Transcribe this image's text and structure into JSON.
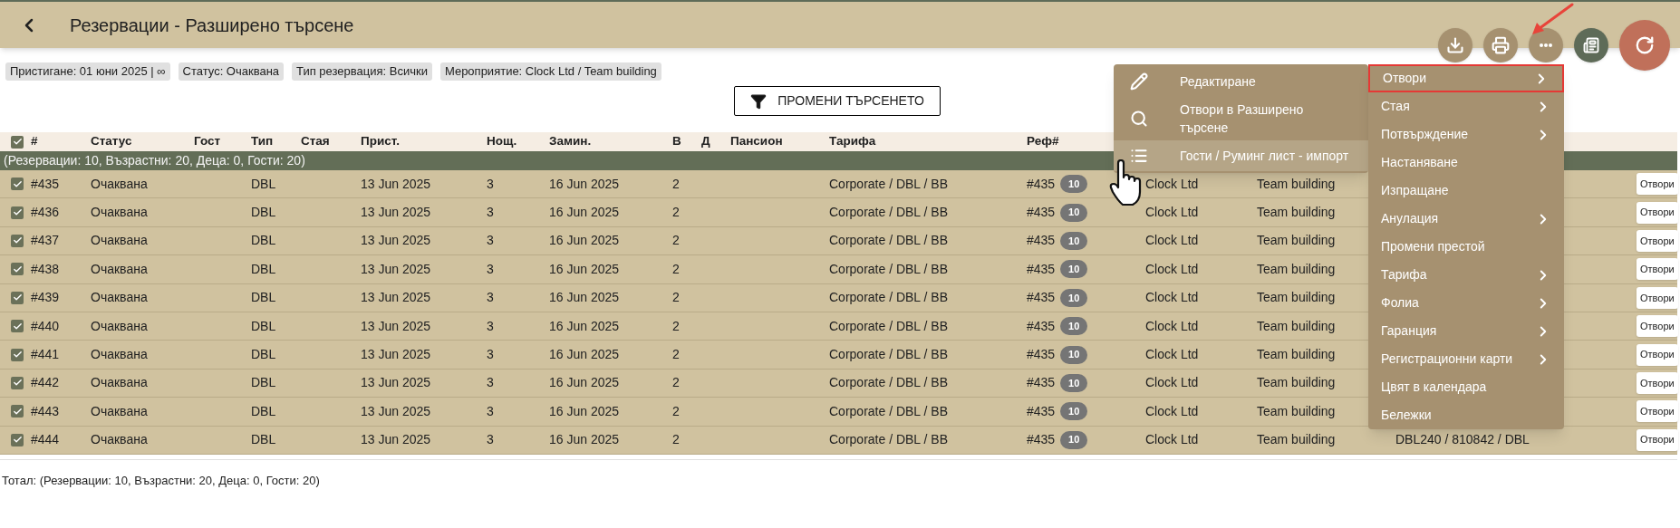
{
  "header": {
    "title": "Резервации - Разширено търсене"
  },
  "actions": [
    {
      "kind": "download"
    },
    {
      "kind": "print"
    },
    {
      "kind": "more"
    },
    {
      "kind": "document"
    },
    {
      "kind": "refresh"
    }
  ],
  "filters": [
    "Пристигане: 01 юни 2025 | ∞",
    "Статус: Очаквана",
    "Тип резервация: Всички",
    "Мероприятие: Clock Ltd / Team building"
  ],
  "search_button": "ПРОМЕНИ ТЪРСЕНЕТО",
  "table": {
    "select_all": {
      "checked": true
    },
    "columns": [
      "#",
      "Статус",
      "Гост",
      "Тип",
      "Стая",
      "Прист.",
      "Нощ.",
      "Замин.",
      "В",
      "Д",
      "Пансион",
      "Тарифа",
      "Реф#"
    ],
    "group_row": "(Резервации: 10, Възрастни: 20, Деца: 0, Гости: 20)",
    "rows": [
      {
        "checked": true,
        "number": "#435",
        "status": "Очаквана",
        "type": "DBL",
        "arrival": "13 Jun 2025",
        "nights": "3",
        "departure": "16 Jun 2025",
        "adults": "2",
        "tariff": "Corporate / DBL / BB",
        "ref": "#435",
        "ref_count": "10",
        "company": "Clock Ltd",
        "event": "Team building",
        "action": "Отвори"
      },
      {
        "checked": true,
        "number": "#436",
        "status": "Очаквана",
        "type": "DBL",
        "arrival": "13 Jun 2025",
        "nights": "3",
        "departure": "16 Jun 2025",
        "adults": "2",
        "tariff": "Corporate / DBL / BB",
        "ref": "#435",
        "ref_count": "10",
        "company": "Clock Ltd",
        "event": "Team building",
        "action": "Отвори"
      },
      {
        "checked": true,
        "number": "#437",
        "status": "Очаквана",
        "type": "DBL",
        "arrival": "13 Jun 2025",
        "nights": "3",
        "departure": "16 Jun 2025",
        "adults": "2",
        "tariff": "Corporate / DBL / BB",
        "ref": "#435",
        "ref_count": "10",
        "company": "Clock Ltd",
        "event": "Team building",
        "action": "Отвори"
      },
      {
        "checked": true,
        "number": "#438",
        "status": "Очаквана",
        "type": "DBL",
        "arrival": "13 Jun 2025",
        "nights": "3",
        "departure": "16 Jun 2025",
        "adults": "2",
        "tariff": "Corporate / DBL / BB",
        "ref": "#435",
        "ref_count": "10",
        "company": "Clock Ltd",
        "event": "Team building",
        "action": "Отвори"
      },
      {
        "checked": true,
        "number": "#439",
        "status": "Очаквана",
        "type": "DBL",
        "arrival": "13 Jun 2025",
        "nights": "3",
        "departure": "16 Jun 2025",
        "adults": "2",
        "tariff": "Corporate / DBL / BB",
        "ref": "#435",
        "ref_count": "10",
        "company": "Clock Ltd",
        "event": "Team building",
        "action": "Отвори"
      },
      {
        "checked": true,
        "number": "#440",
        "status": "Очаквана",
        "type": "DBL",
        "arrival": "13 Jun 2025",
        "nights": "3",
        "departure": "16 Jun 2025",
        "adults": "2",
        "tariff": "Corporate / DBL / BB",
        "ref": "#435",
        "ref_count": "10",
        "company": "Clock Ltd",
        "event": "Team building",
        "action": "Отвори"
      },
      {
        "checked": true,
        "number": "#441",
        "status": "Очаквана",
        "type": "DBL",
        "arrival": "13 Jun 2025",
        "nights": "3",
        "departure": "16 Jun 2025",
        "adults": "2",
        "tariff": "Corporate / DBL / BB",
        "ref": "#435",
        "ref_count": "10",
        "company": "Clock Ltd",
        "event": "Team building",
        "action": "Отвори"
      },
      {
        "checked": true,
        "number": "#442",
        "status": "Очаквана",
        "type": "DBL",
        "arrival": "13 Jun 2025",
        "nights": "3",
        "departure": "16 Jun 2025",
        "adults": "2",
        "tariff": "Corporate / DBL / BB",
        "ref": "#435",
        "ref_count": "10",
        "company": "Clock Ltd",
        "event": "Team building",
        "action": "Отвори"
      },
      {
        "checked": true,
        "number": "#443",
        "status": "Очаквана",
        "type": "DBL",
        "arrival": "13 Jun 2025",
        "nights": "3",
        "departure": "16 Jun 2025",
        "adults": "2",
        "tariff": "Corporate / DBL / BB",
        "ref": "#435",
        "ref_count": "10",
        "company": "Clock Ltd",
        "event": "Team building",
        "action": "Отвори"
      },
      {
        "checked": true,
        "number": "#444",
        "status": "Очаквана",
        "type": "DBL",
        "arrival": "13 Jun 2025",
        "nights": "3",
        "departure": "16 Jun 2025",
        "adults": "2",
        "tariff": "Corporate / DBL / BB",
        "ref": "#435",
        "ref_count": "10",
        "company": "Clock Ltd",
        "event": "Team building",
        "column_17": "DBL240 / 810842 / DBL",
        "action": "Отвори"
      }
    ]
  },
  "context_menu": {
    "items": [
      {
        "kind": "edit",
        "label": "Редактиране",
        "selected": false
      },
      {
        "kind": "search",
        "label": "Отвори в Разширено търсене",
        "selected": false
      },
      {
        "kind": "list",
        "label": "Гости / Руминг лист - импорт",
        "selected": true
      }
    ]
  },
  "submenu": {
    "items": [
      {
        "label": "Отвори",
        "has_submenu": true,
        "selected": true
      },
      {
        "label": "Стая",
        "has_submenu": true,
        "selected": false
      },
      {
        "label": "Потвърждение",
        "has_submenu": true,
        "selected": false
      },
      {
        "label": "Настаняване",
        "has_submenu": false,
        "selected": false
      },
      {
        "label": "Изпращане",
        "has_submenu": false,
        "selected": false
      },
      {
        "label": "Анулация",
        "has_submenu": true,
        "selected": false
      },
      {
        "label": "Промени престой",
        "has_submenu": false,
        "selected": false
      },
      {
        "label": "Тарифа",
        "has_submenu": true,
        "selected": false
      },
      {
        "label": "Фолиа",
        "has_submenu": true,
        "selected": false
      },
      {
        "label": "Гаранция",
        "has_submenu": true,
        "selected": false
      },
      {
        "label": "Регистрационни карти",
        "has_submenu": true,
        "selected": false
      },
      {
        "label": "Цвят в календара",
        "has_submenu": false,
        "selected": false
      },
      {
        "label": "Бележки",
        "has_submenu": false,
        "selected": false
      }
    ]
  },
  "total": "Тотал: (Резервации: 10, Възрастни: 20, Деца: 0, Гости: 20)"
}
